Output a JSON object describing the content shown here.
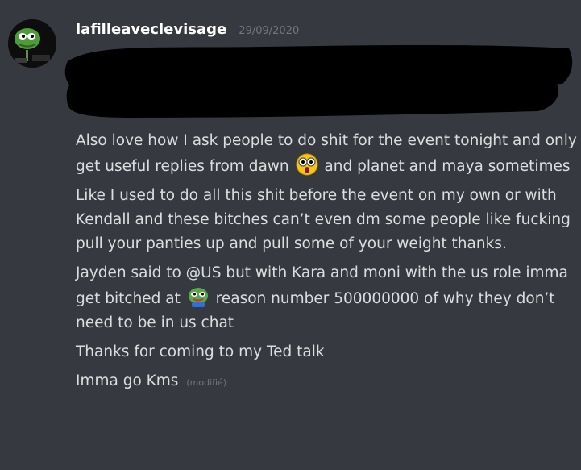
{
  "author": {
    "username": "lafilleaveclevisage",
    "timestamp": "29/09/2020",
    "avatar_icon": "pepe-frog-avatar-icon"
  },
  "messages": [
    {
      "before": "Also love how I ask people to do shit for the event tonight and only get useful replies from dawn",
      "emoji": "surprised-face-emoji-icon",
      "after": "and planet and maya sometimes"
    },
    {
      "text": "Like I used to do all this shit before the event on my own or with Kendall and these bitches can’t even dm some people like fucking pull your panties up and pull some of your weight thanks."
    },
    {
      "before": "Jayden said to @US but with Kara and moni with the us role imma get bitched at",
      "emoji": "pepe-frog-emoji-icon",
      "after": "reason number 500000000 of why they don’t need to be in us chat"
    },
    {
      "text": "Thanks for coming to my Ted talk"
    },
    {
      "text": "Imma go Kms",
      "edited_label": "(modifié)"
    }
  ],
  "colors": {
    "background": "#36393f",
    "username": "#ffffff",
    "text": "#dcddde",
    "muted": "#72767d",
    "redaction": "#000000"
  }
}
